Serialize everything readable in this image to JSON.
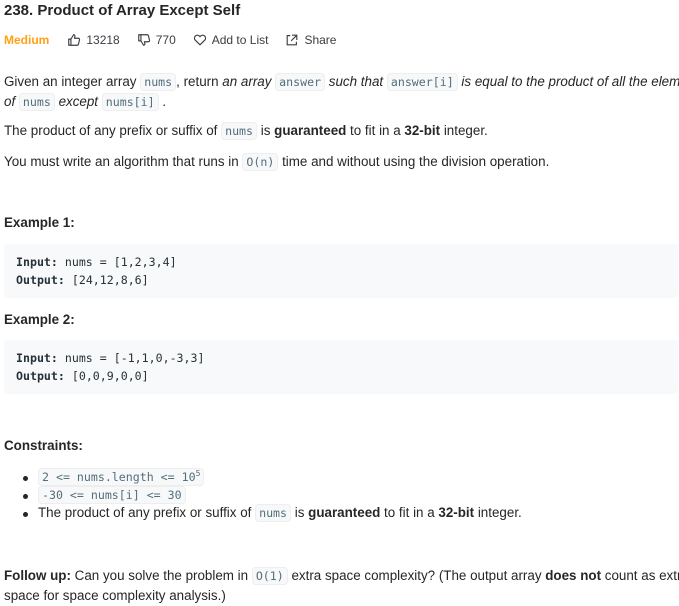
{
  "problem": {
    "title": "238. Product of Array Except Self",
    "difficulty": "Medium",
    "likes": "13218",
    "dislikes": "770",
    "add_to_list": "Add to List",
    "share": "Share"
  },
  "description": {
    "p1": {
      "a": "Given an integer array ",
      "code1": "nums",
      "b": ", return ",
      "em1": "an array",
      "code2": "answer",
      "em2": "such that",
      "code3": "answer[i]",
      "em3": "is equal to the product of all the elements",
      "em4": "of",
      "code4": "nums",
      "em5": "except",
      "code5": "nums[i]",
      "end": "."
    },
    "p2": {
      "a": "The product of any prefix or suffix of ",
      "code": "nums",
      "b": " is ",
      "strong1": "guaranteed",
      "c": " to fit in a ",
      "strong2": "32-bit",
      "d": " integer."
    },
    "p3": {
      "a": "You must write an algorithm that runs in ",
      "code": "O(n)",
      "b": " time and without using the division operation."
    }
  },
  "examples": [
    {
      "heading": "Example 1:",
      "input_label": "Input:",
      "input": " nums = [1,2,3,4]",
      "output_label": "Output:",
      "output": " [24,12,8,6]"
    },
    {
      "heading": "Example 2:",
      "input_label": "Input:",
      "input": " nums = [-1,1,0,-3,3]",
      "output_label": "Output:",
      "output": " [0,0,9,0,0]"
    }
  ],
  "constraints": {
    "heading": "Constraints:",
    "c1_code": "2 <= nums.length <= 10",
    "c1_sup": "5",
    "c2_code": "-30 <= nums[i] <= 30",
    "c3": {
      "a": "The product of any prefix or suffix of ",
      "code": "nums",
      "b": " is ",
      "strong1": "guaranteed",
      "c": " to fit in a ",
      "strong2": "32-bit",
      "d": " integer."
    }
  },
  "follow_up": {
    "label": "Follow up:",
    "a": " Can you solve the problem in ",
    "code": "O(1)",
    "b": " extra space complexity? (The output array ",
    "strong": "does not",
    "c": " count as extra",
    "line2": "space for space complexity analysis.)"
  },
  "icons": {
    "like": "thumbs-up-icon",
    "dislike": "thumbs-down-icon",
    "add": "heart-icon",
    "share": "share-icon"
  },
  "colors": {
    "difficulty_medium": "#ffa116",
    "code_bg": "#f7f8fa",
    "example_bg": "#f7f9fa"
  }
}
